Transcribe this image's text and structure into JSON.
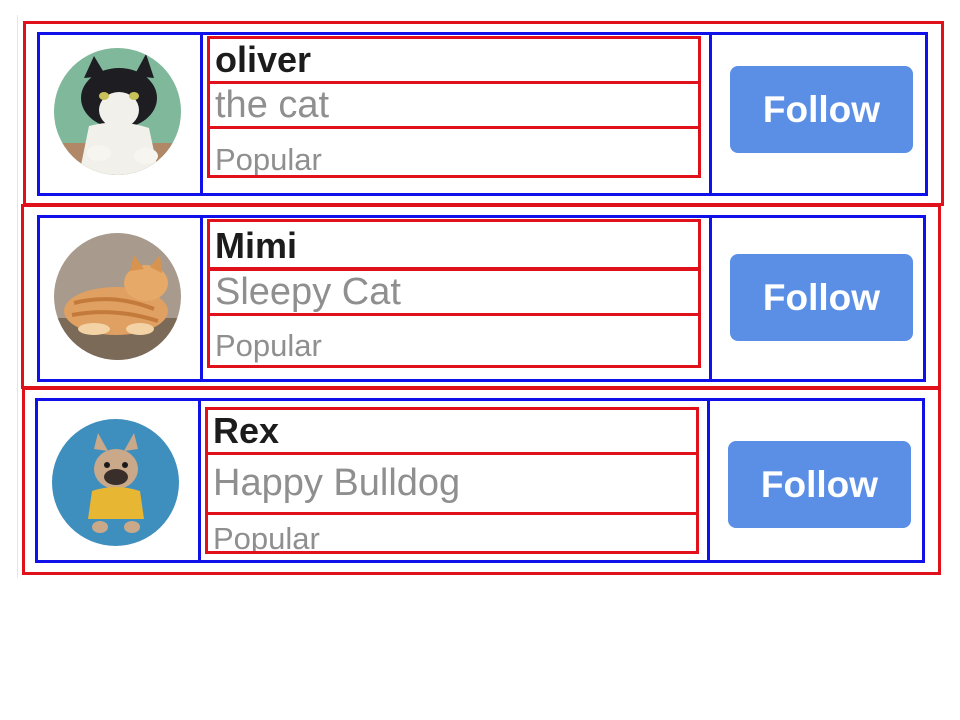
{
  "users": [
    {
      "name": "oliver",
      "subtitle": "the cat",
      "badge": "Popular",
      "button_label": "Follow",
      "avatar_icon": "tuxedo-cat-photo"
    },
    {
      "name": "Mimi",
      "subtitle": "Sleepy Cat",
      "badge": "Popular",
      "button_label": "Follow",
      "avatar_icon": "orange-tabby-cat-photo"
    },
    {
      "name": "Rex",
      "subtitle": "Happy Bulldog",
      "badge": "Popular",
      "button_label": "Follow",
      "avatar_icon": "french-bulldog-photo"
    }
  ],
  "colors": {
    "follow_button": "#5b8fe6",
    "name_text": "#1c1c1c",
    "secondary_text": "#8f8f8f",
    "outline_red": "#e0111b",
    "outline_blue": "#1010e8"
  }
}
